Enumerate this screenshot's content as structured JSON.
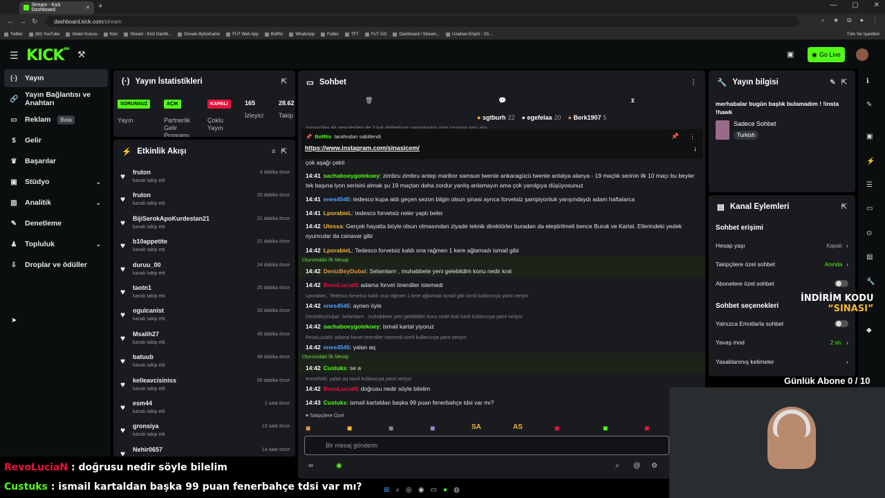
{
  "browser": {
    "tab_title": "Stream - Kick Dashboard",
    "url_host": "dashboard.kick.com",
    "url_path": "/stream",
    "bookmarks": [
      "Twitter",
      "(60) YouTube",
      "Gelen Kutusu",
      "Kick",
      "Stream - Kick Dashb...",
      "Donate ByNoGame",
      "FUT Web App",
      "BotRix",
      "WhatsApp",
      "Futbin",
      "TFT",
      "FUT GG",
      "Dashboard / Stream...",
      "Uzaktan Erişim - Ch..."
    ],
    "all_bookmarks": "Tüm Yer İşaretleri"
  },
  "header": {
    "logo": "KICK",
    "logo_sup": "BETA",
    "go_live": "Go Live",
    "colors": {
      "brand": "#53fc18"
    }
  },
  "sidebar": {
    "items": [
      {
        "label": "Yayın",
        "icon": "stream-icon",
        "active": true
      },
      {
        "label": "Yayın Bağlantısı ve Anahtarı",
        "icon": "key-icon"
      },
      {
        "label": "Reklam",
        "icon": "ad-icon",
        "badge": "Beta"
      },
      {
        "label": "Gelir",
        "icon": "money-icon"
      },
      {
        "label": "Başarılar",
        "icon": "trophy-icon"
      },
      {
        "label": "Stüdyo",
        "icon": "studio-icon",
        "chevron": true
      },
      {
        "label": "Analitik",
        "icon": "analytics-icon",
        "chevron": true
      },
      {
        "label": "Denetleme",
        "icon": "moderation-icon"
      },
      {
        "label": "Topluluk",
        "icon": "community-icon",
        "chevron": true
      },
      {
        "label": "Droplar ve ödüller",
        "icon": "drops-icon"
      }
    ]
  },
  "stats": {
    "title": "Yayın İstatistikleri",
    "badges": [
      {
        "text": "SORUNSUZ",
        "label": "Yayın",
        "color": "#53fc18"
      },
      {
        "text": "AÇIK",
        "label": "Partnerlik Gelir Programı",
        "color": "#53fc18"
      },
      {
        "text": "KAPALI",
        "label": "Çoklu Yayın",
        "color": "#e9113c"
      }
    ],
    "viewers": "165",
    "viewers_label": "İzleyici",
    "followers": "28.62",
    "followers_label": "Takip"
  },
  "feed": {
    "title": "Etkinlik Akışı",
    "items": [
      {
        "name": "fruton",
        "sub": "kanalı takip etti",
        "time": "4 dakika önce"
      },
      {
        "name": "fruton",
        "sub": "kanalı takip etti",
        "time": "20 dakika önce"
      },
      {
        "name": "BijiSerokApoKurdestan21",
        "sub": "kanalı takip etti",
        "time": "21 dakika önce"
      },
      {
        "name": "b10appetite",
        "sub": "kanalı takip etti",
        "time": "21 dakika önce"
      },
      {
        "name": "duruu_00",
        "sub": "kanalı takip etti",
        "time": "24 dakika önce"
      },
      {
        "name": "taotn1",
        "sub": "kanalı takip etti",
        "time": "25 dakika önce"
      },
      {
        "name": "ogulcanist",
        "sub": "kanalı takip etti",
        "time": "33 dakika önce"
      },
      {
        "name": "Msalih27",
        "sub": "kanalı takip etti",
        "time": "45 dakika önce"
      },
      {
        "name": "batuub",
        "sub": "kanalı takip etti",
        "time": "46 dakika önce"
      },
      {
        "name": "kelleavcisiniss",
        "sub": "kanalı takip etti",
        "time": "56 dakika önce"
      },
      {
        "name": "esm44",
        "sub": "kanalı takip etti",
        "time": "1 saat önce"
      },
      {
        "name": "gronsiya",
        "sub": "kanalı takip etti",
        "time": "13 saat önce"
      },
      {
        "name": "Nehir0657",
        "sub": "kanalı takip etti",
        "time": "14 saat önce"
      }
    ]
  },
  "chat": {
    "title": "Sohbet",
    "gifters": [
      {
        "name": "sgtburh",
        "n": "22",
        "color": "#f5b82e"
      },
      {
        "name": "egefelaa",
        "n": "20",
        "color": "#ddd"
      },
      {
        "name": "Berk1907",
        "n": "5",
        "color": "#e8914a"
      }
    ],
    "pinned_by": "BotRix",
    "pinned_by_suffix": "tarafından sabitlendi",
    "pinned_link": "https://www.instagram.com/sinasicem/",
    "hidden_line_top": "şsrum'dan da gençlerden de 2 kat değerliyse yapmamam yine cezama tam aiyi",
    "partial_line": "çok aşağı çekti",
    "messages": [
      {
        "time": "14:41",
        "user": "sachaboeygotekoey",
        "color": "#53fc18",
        "text": "zimbru zimbru antep maribor samsun twente ankaragücü twente antalya alanya - 19 maçlık serinin ilk 10 maçı bu beyler tek başına lyon serisini almak şu 19 maçtan daha zordur yanlış anlamayın ama çok yanılgıya düşüyosunuz"
      },
      {
        "time": "14:41",
        "user": "enes4545",
        "color": "#4aa3ff",
        "text": "tedesco kupa aldı geçen sezon bilgin olsun şinasi ayrıca forvetsiz şampiyonluk yarışındaydı adam haftalarca"
      },
      {
        "time": "14:41",
        "user": "LporabieL",
        "color": "#f5b82e",
        "text": "tedesco forvetsiz neler yaptı beler"
      },
      {
        "time": "14:42",
        "user": "Utessa",
        "color": "#f5b82e",
        "text": "Gerçek hayatta böyle olsun olmasından ziyade teknik direktörler buradan da eleştirilmeli bence Buruk ve Kartal. Ellerindeki yedek oyuncular da canavar gibi"
      },
      {
        "time": "14:42",
        "user": "LporabieL",
        "color": "#f5b82e",
        "text": "Tedesco forvetsiz kaldı ona rağmen 1 kere ağlamadı ismail gibi"
      }
    ],
    "first_label": "Oturumdaki İlk Mesajı",
    "first1": {
      "time": "14:42",
      "user": "DenizBeyDubai",
      "color": "#e8914a",
      "text": "Selamlarrr , muhabbete yeni gelebildim konu nedir kral"
    },
    "m2": {
      "time": "14:42",
      "user": "RevoLuciaN",
      "color": "#e9113c",
      "text": "adama forvet önerdiler istemedi"
    },
    "r1": "LporabieL: Tedesco forvetsiz kaldı ona rağmen 1 kere ağlamadı ismail gibi isimli kullanıcıya yanıt veriyor",
    "m3": {
      "time": "14:42",
      "user": "enes4545",
      "color": "#4aa3ff",
      "text": "aynen öyle"
    },
    "r2": "DenizBeyDubai: Selamlarrr , muhabbete yeni gelebildim konu nedir kral isimli kullanıcıya yanıt veriyor",
    "m4": {
      "time": "14:42",
      "user": "sachaboeygotekoey",
      "color": "#53fc18",
      "text": "ismail kartal yiyoruz"
    },
    "r3": "RevoLuciaN: adama forvet önerdiler istemedi isimli kullanıcıya yanıt veriyor",
    "m5": {
      "time": "14:42",
      "user": "enes4545",
      "color": "#4aa3ff",
      "text": "yalan aq"
    },
    "first2": {
      "time": "14:42",
      "user": "Custuks",
      "color": "#53fc18",
      "text": "se a"
    },
    "r4": "enes4545: yalan aq isimli kullanıcıya yanıt veriyor",
    "m6": {
      "time": "14:42",
      "user": "RevoLuciaN",
      "color": "#e9113c",
      "text": "doğrusu nedir söyle bilelim"
    },
    "m7": {
      "time": "14:43",
      "user": "Custuks",
      "color": "#53fc18",
      "text": "ismail kartaldan başka 99 puan fenerbahçe tdsi var mı?"
    },
    "followers_only": "Takipçilere Özel",
    "emotes": [
      "SA",
      "AS"
    ],
    "input_placeholder": "Bir mesaj gönderin"
  },
  "info": {
    "title": "Yayın bilgisi",
    "stream_title": "merhabalar bugün başlık bulamadım ! !insta !hawk",
    "category": "Sadece Sohbet",
    "tag": "Turkish"
  },
  "actions": {
    "title": "Kanal Eylemleri",
    "access": "Sohbet erişimi",
    "rows1": [
      {
        "label": "Hesap yaşı",
        "value": "Kapalı"
      },
      {
        "label": "Takipçilere özel sohbet",
        "value": "Anında"
      },
      {
        "label": "Abonelere özel sohbet"
      }
    ],
    "options": "Sohbet seçenekleri",
    "rows2": [
      {
        "label": "Yalnızca Emotlarla sohbet"
      },
      {
        "label": "Yavaş mod",
        "value": "2 sn."
      },
      {
        "label": "Yasaklanmış kelimeler"
      }
    ]
  },
  "overlay": {
    "discount_line1": "İNDİRİM KODU",
    "discount_line2": "“SINASI”",
    "daily_subs": "Günlük Abone 0 / 10",
    "o1_user": "RevoLuciaN",
    "o1_text": " : doğrusu nedir söyle bilelim",
    "o2_user": "Custuks",
    "o2_text": " : ismail kartaldan başka 99 puan fenerbahçe tdsi var mı?",
    "o1_color": "#e9113c",
    "o2_color": "#53fc18"
  }
}
